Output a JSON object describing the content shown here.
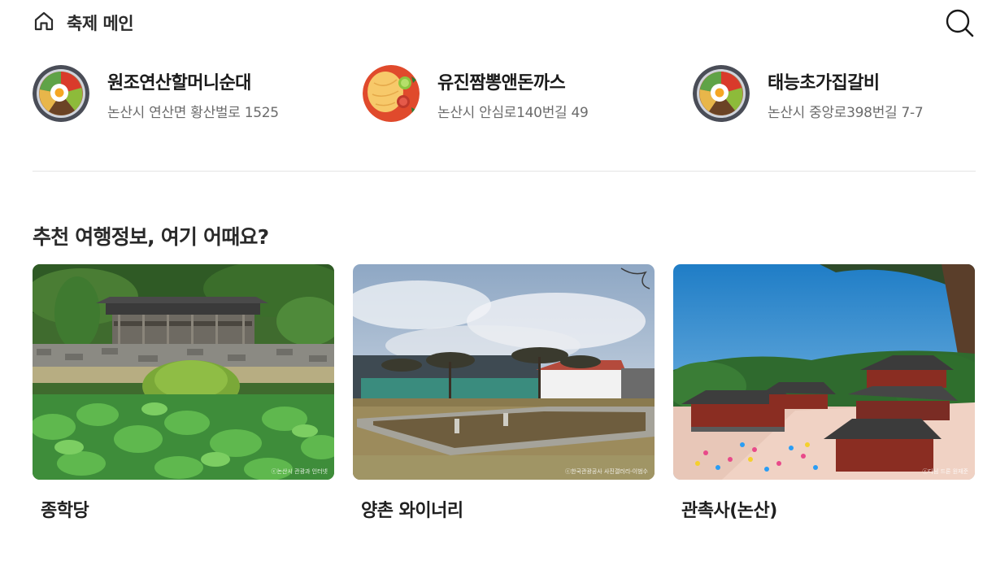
{
  "header": {
    "title": "축제 메인",
    "home_icon": "home-icon",
    "search_icon": "search-icon"
  },
  "restaurants": [
    {
      "name": "원조연산할머니순대",
      "address": "논산시 연산면 황산벌로 1525",
      "icon": "bibimbap-icon"
    },
    {
      "name": "유진짬뽕앤돈까스",
      "address": "논산시 안심로140번길 49",
      "icon": "omelet-plate-icon"
    },
    {
      "name": "태능초가집갈비",
      "address": "논산시 중앙로398번길 7-7",
      "icon": "bibimbap-icon"
    }
  ],
  "recommend": {
    "title": "추천 여행정보, 여기 어때요?",
    "cards": [
      {
        "title": "종학당",
        "credit": "ⓒ논산시 관광과 인터넷"
      },
      {
        "title": "양촌 와이너리",
        "credit": "ⓒ한국관광공사 사진갤러리-이범수"
      },
      {
        "title": "관촉사(논산)",
        "credit": "ⓒ다님 드론 원재준"
      }
    ]
  },
  "colors": {
    "text_primary": "#1f1f1f",
    "text_secondary": "#6b6b6b",
    "divider": "#e4e4e4"
  }
}
